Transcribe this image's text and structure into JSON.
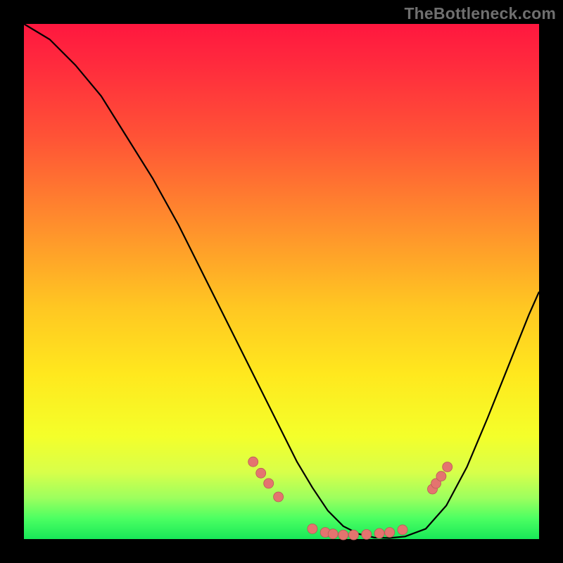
{
  "watermark": "TheBottleneck.com",
  "colors": {
    "background": "#000000",
    "gradient_top": "#ff173f",
    "gradient_bottom": "#18e858",
    "dot_fill": "#e4746f",
    "curve_stroke": "#000000"
  },
  "chart_data": {
    "type": "line",
    "title": "",
    "xlabel": "",
    "ylabel": "",
    "xlim": [
      0,
      1
    ],
    "ylim": [
      0,
      1
    ],
    "series": [
      {
        "name": "bottleneck-curve",
        "x": [
          0.0,
          0.05,
          0.1,
          0.15,
          0.2,
          0.25,
          0.3,
          0.35,
          0.4,
          0.45,
          0.5,
          0.53,
          0.56,
          0.59,
          0.62,
          0.65,
          0.68,
          0.71,
          0.74,
          0.78,
          0.82,
          0.86,
          0.9,
          0.94,
          0.98,
          1.0
        ],
        "y": [
          1.0,
          0.97,
          0.92,
          0.86,
          0.78,
          0.7,
          0.61,
          0.51,
          0.41,
          0.31,
          0.21,
          0.15,
          0.1,
          0.055,
          0.025,
          0.01,
          0.003,
          0.002,
          0.005,
          0.02,
          0.065,
          0.14,
          0.235,
          0.335,
          0.435,
          0.48
        ]
      }
    ],
    "annotations": {
      "highlighted_dots": [
        {
          "x": 0.445,
          "y": 0.15
        },
        {
          "x": 0.46,
          "y": 0.128
        },
        {
          "x": 0.475,
          "y": 0.108
        },
        {
          "x": 0.494,
          "y": 0.082
        },
        {
          "x": 0.56,
          "y": 0.02
        },
        {
          "x": 0.585,
          "y": 0.013
        },
        {
          "x": 0.6,
          "y": 0.01
        },
        {
          "x": 0.62,
          "y": 0.008
        },
        {
          "x": 0.64,
          "y": 0.008
        },
        {
          "x": 0.665,
          "y": 0.009
        },
        {
          "x": 0.69,
          "y": 0.011
        },
        {
          "x": 0.71,
          "y": 0.013
        },
        {
          "x": 0.735,
          "y": 0.018
        },
        {
          "x": 0.793,
          "y": 0.097
        },
        {
          "x": 0.8,
          "y": 0.108
        },
        {
          "x": 0.81,
          "y": 0.122
        },
        {
          "x": 0.822,
          "y": 0.14
        }
      ]
    }
  }
}
